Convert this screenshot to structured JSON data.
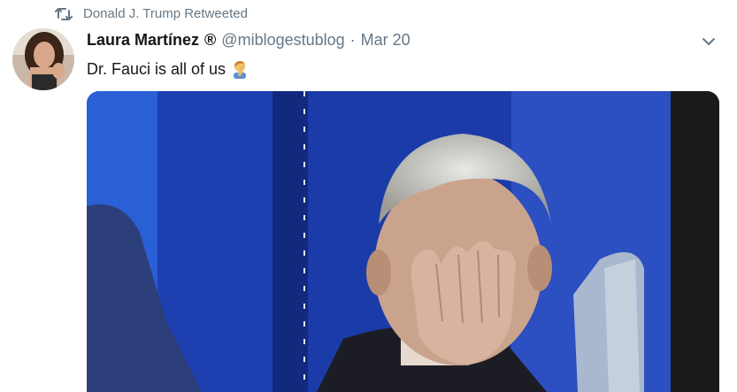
{
  "retweet": {
    "icon": "retweet-icon",
    "text": "Donald J. Trump Retweeted"
  },
  "tweet": {
    "author_name": "Laura Martínez",
    "badge": "®",
    "handle": "@miblogestublog",
    "separator": "·",
    "date": "Mar 20",
    "text": "Dr. Fauci is all of us",
    "emoji_icon": "facepalm-emoji-icon",
    "menu_icon": "chevron-down-icon"
  },
  "colors": {
    "secondary_text": "#657786",
    "primary_text": "#14171a",
    "background": "#ffffff"
  }
}
